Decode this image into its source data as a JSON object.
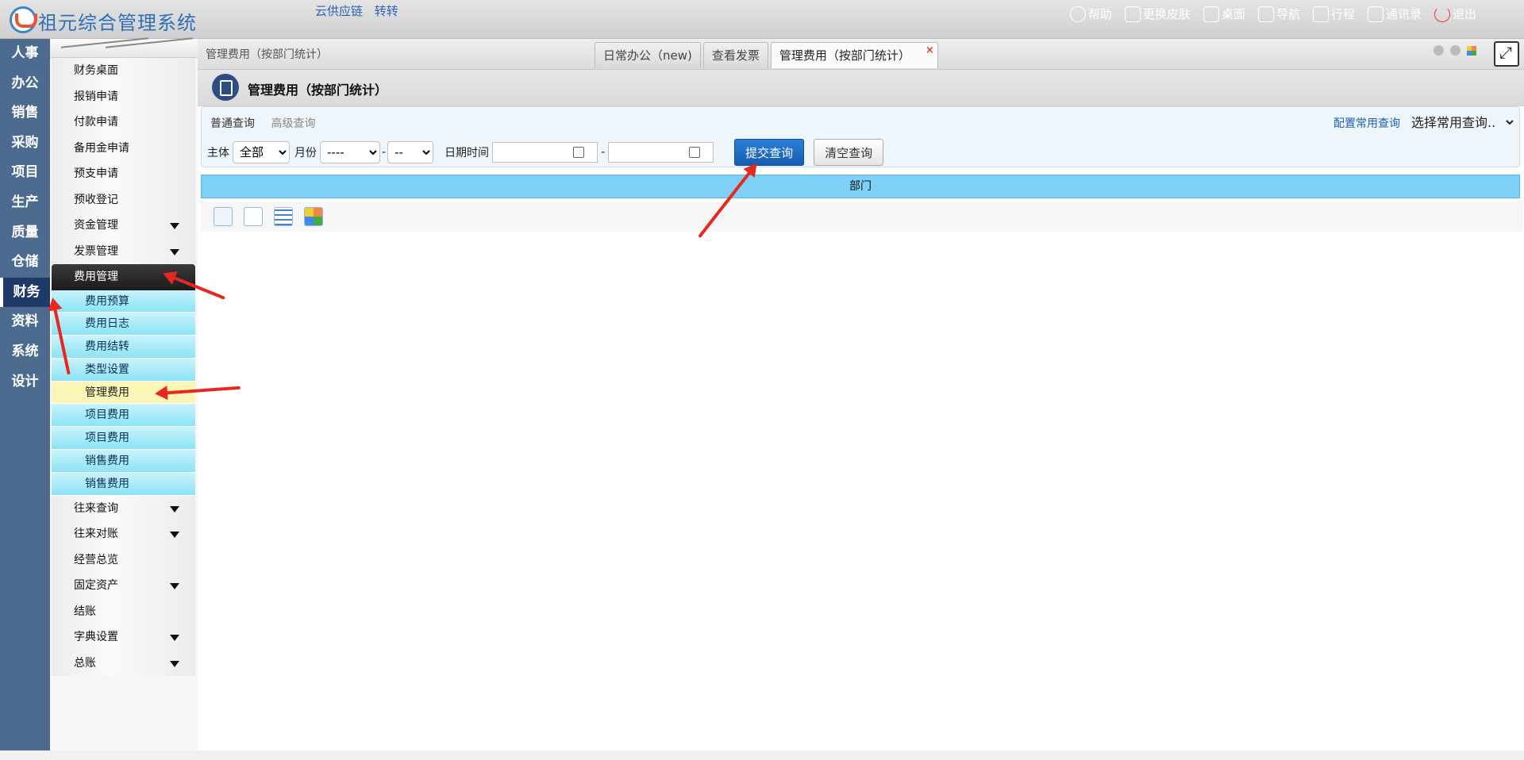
{
  "app": {
    "title": "祖元综合管理系统"
  },
  "top_links": [
    "云供应链",
    "转转"
  ],
  "top_actions": [
    "帮助",
    "更换皮肤",
    "桌面",
    "导航",
    "行程",
    "通讯录",
    "退出"
  ],
  "left_modules": [
    "人事",
    "办公",
    "销售",
    "采购",
    "项目",
    "生产",
    "质量",
    "仓储",
    "财务",
    "资料",
    "系统",
    "设计"
  ],
  "active_module": "财务",
  "sidebar": {
    "items": [
      {
        "label": "财务桌面"
      },
      {
        "label": "报销申请"
      },
      {
        "label": "付款申请"
      },
      {
        "label": "备用金申请"
      },
      {
        "label": "预支申请"
      },
      {
        "label": "预收登记"
      },
      {
        "label": "资金管理",
        "expandable": true
      },
      {
        "label": "发票管理",
        "expandable": true
      },
      {
        "label": "费用管理",
        "expandable": true,
        "active": true
      }
    ],
    "sub_items": [
      {
        "label": "费用预算"
      },
      {
        "label": "费用日志"
      },
      {
        "label": "费用结转"
      },
      {
        "label": "类型设置"
      },
      {
        "label": "管理费用",
        "selected": true
      },
      {
        "label": "项目费用"
      },
      {
        "label": "项目费用"
      },
      {
        "label": "销售费用"
      },
      {
        "label": "销售费用"
      }
    ],
    "items_after": [
      {
        "label": "往来查询",
        "expandable": true
      },
      {
        "label": "往来对账",
        "expandable": true
      },
      {
        "label": "经营总览"
      },
      {
        "label": "固定资产",
        "expandable": true
      },
      {
        "label": "结账"
      },
      {
        "label": "字典设置",
        "expandable": true
      },
      {
        "label": "总账",
        "expandable": true
      }
    ]
  },
  "breadcrumb": "管理费用（按部门统计）",
  "tabs": [
    {
      "label": "日常办公（new)"
    },
    {
      "label": "查看发票"
    },
    {
      "label": "管理费用（按部门统计）",
      "active": true,
      "close": "×"
    }
  ],
  "page_title": "管理费用（按部门统计）",
  "query": {
    "tab_normal": "普通查询",
    "tab_advanced": "高级查询",
    "config_link": "配置常用查询",
    "common_select": "选择常用查询..",
    "entity_label": "主体",
    "entity_value": "全部",
    "month_label": "月份",
    "month_value1": "----",
    "month_sep": "-",
    "month_value2": "--",
    "datetime_label": "日期时间",
    "date_sep": "-",
    "submit": "提交查询",
    "clear": "清空查询"
  },
  "table": {
    "header": "部门"
  },
  "toolbar_icons": [
    "list-view-icon",
    "page-icon",
    "grid-icon",
    "image-icon"
  ],
  "colors": {
    "sidebar_nav": "#4c6b8f",
    "accent": "#155cb3",
    "header_strip": "#7fd0f7",
    "annotation": "#e8281e"
  }
}
